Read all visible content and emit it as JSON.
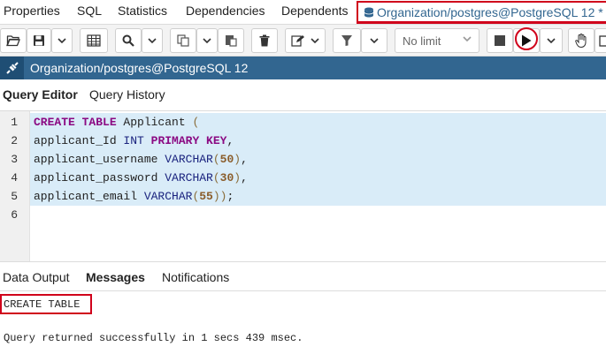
{
  "top_tabs": [
    {
      "label": "Properties"
    },
    {
      "label": "SQL"
    },
    {
      "label": "Statistics"
    },
    {
      "label": "Dependencies"
    },
    {
      "label": "Dependents"
    }
  ],
  "active_tab": {
    "label": "Organization/postgres@PostgreSQL 12 *",
    "icon": "database-icon"
  },
  "toolbar": {
    "limit_label": "No limit",
    "icons": [
      "open-file-icon",
      "save-icon",
      "chevron-down-icon",
      "grid-icon",
      "search-icon",
      "copy-icon",
      "paste-icon",
      "trash-icon",
      "edit-icon",
      "filter-icon",
      "stop-icon",
      "play-icon",
      "hand-icon"
    ]
  },
  "connection": {
    "title": "Organization/postgres@PostgreSQL 12"
  },
  "editor_tabs": [
    {
      "label": "Query Editor",
      "active": true
    },
    {
      "label": "Query History",
      "active": false
    }
  ],
  "editor": {
    "line_numbers": [
      "1",
      "2",
      "3",
      "4",
      "5",
      "6"
    ],
    "lines": [
      "CREATE TABLE Applicant (",
      "applicant_Id INT PRIMARY KEY,",
      "applicant_username VARCHAR(50),",
      "applicant_password VARCHAR(30),",
      "applicant_email VARCHAR(55));",
      ""
    ]
  },
  "output_tabs": [
    {
      "label": "Data Output",
      "active": false
    },
    {
      "label": "Messages",
      "active": true
    },
    {
      "label": "Notifications",
      "active": false
    }
  ],
  "messages": {
    "result": "CREATE TABLE",
    "status": "Query returned successfully in 1 secs 439 msec."
  },
  "colors": {
    "accent": "#326690",
    "highlight": "#d0021b",
    "selection": "#d9ecf8"
  }
}
